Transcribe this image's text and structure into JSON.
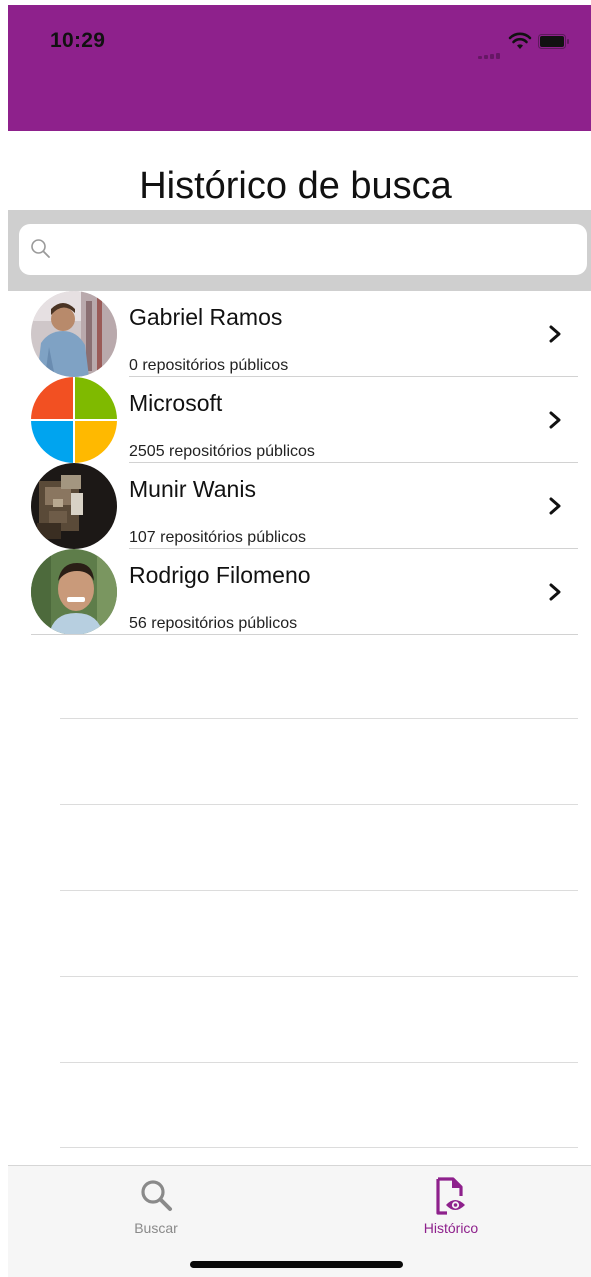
{
  "status_bar": {
    "time": "10:29",
    "background_color": "#8e218c"
  },
  "page": {
    "title": "Histórico de busca"
  },
  "search": {
    "value": "",
    "placeholder": "",
    "icon": "search-icon"
  },
  "users": [
    {
      "name": "Gabriel Ramos",
      "subtitle": "0 repositórios públicos",
      "avatar": "photo-avatar"
    },
    {
      "name": "Microsoft",
      "subtitle": "2505 repositórios públicos",
      "avatar": "microsoft-logo-avatar"
    },
    {
      "name": "Munir Wanis",
      "subtitle": "107 repositórios públicos",
      "avatar": "photo-avatar"
    },
    {
      "name": "Rodrigo Filomeno",
      "subtitle": "56 repositórios públicos",
      "avatar": "photo-avatar"
    }
  ],
  "tab_bar": {
    "tabs": [
      {
        "label": "Buscar",
        "icon": "search-icon",
        "selected": false
      },
      {
        "label": "Histórico",
        "icon": "document-eye-icon",
        "selected": true
      }
    ],
    "accent_color": "#8e218c",
    "inactive_color": "#8a8a8a"
  }
}
